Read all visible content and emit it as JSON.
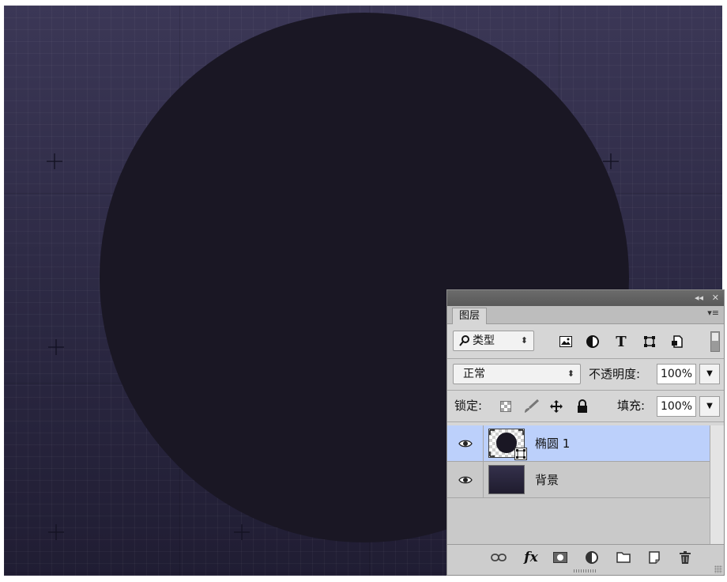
{
  "panel": {
    "tab_label": "图层",
    "collapse_glyph": "◂◂",
    "close_glyph": "✕",
    "menu_glyph": "▾≡",
    "filter": {
      "label": "类型"
    },
    "filter_icons": [
      "image-filter-icon",
      "adjustment-filter-icon",
      "type-filter-icon",
      "shape-filter-icon",
      "smart-object-filter-icon"
    ],
    "blend_mode": "正常",
    "opacity_label": "不透明度:",
    "opacity_value": "100%",
    "lock_label": "锁定:",
    "lock_icons": [
      "lock-transparent-icon",
      "lock-paint-icon",
      "lock-position-icon",
      "lock-all-icon"
    ],
    "fill_label": "填充:",
    "fill_value": "100%",
    "layers": [
      {
        "name": "椭圆 1",
        "selected": true,
        "visible": true,
        "type": "shape"
      },
      {
        "name": "背景",
        "selected": false,
        "visible": true,
        "type": "background"
      }
    ],
    "bottom_icons": [
      "link-layers-icon",
      "fx-icon",
      "add-mask-icon",
      "new-adjustment-icon",
      "new-group-icon",
      "new-layer-icon",
      "delete-layer-icon"
    ]
  },
  "colors": {
    "canvas_top": "#3b3756",
    "canvas_bottom": "#201d33",
    "circle": "#1a1724",
    "selection_highlight": "#bcd0fb"
  }
}
